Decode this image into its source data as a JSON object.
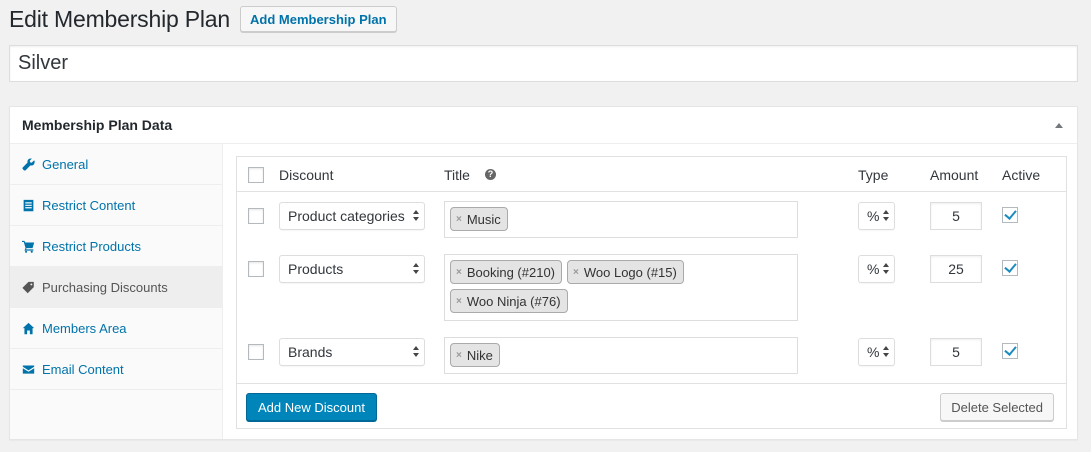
{
  "page": {
    "title": "Edit Membership Plan",
    "add_button": "Add Membership Plan",
    "plan_name": "Silver"
  },
  "postbox": {
    "title": "Membership Plan Data"
  },
  "sidebar": {
    "items": [
      {
        "label": "General",
        "icon": "wrench-icon",
        "active": false
      },
      {
        "label": "Restrict Content",
        "icon": "document-icon",
        "active": false
      },
      {
        "label": "Restrict Products",
        "icon": "cart-icon",
        "active": false
      },
      {
        "label": "Purchasing Discounts",
        "icon": "tag-icon",
        "active": true
      },
      {
        "label": "Members Area",
        "icon": "home-icon",
        "active": false
      },
      {
        "label": "Email Content",
        "icon": "email-icon",
        "active": false
      }
    ]
  },
  "table": {
    "columns": {
      "discount": "Discount",
      "title": "Title",
      "type": "Type",
      "amount": "Amount",
      "active": "Active"
    },
    "rows": [
      {
        "discount": "Product categories",
        "titles": [
          "Music"
        ],
        "type": "%",
        "amount": "5",
        "active": true
      },
      {
        "discount": "Products",
        "titles": [
          "Booking (#210)",
          "Woo Logo (#15)",
          "Woo Ninja (#76)"
        ],
        "type": "%",
        "amount": "25",
        "active": true
      },
      {
        "discount": "Brands",
        "titles": [
          "Nike"
        ],
        "type": "%",
        "amount": "5",
        "active": true
      }
    ]
  },
  "footer": {
    "add_label": "Add New Discount",
    "delete_label": "Delete Selected"
  },
  "colors": {
    "link": "#0073aa",
    "primary_button": "#0085ba",
    "checkmark": "#1e8cbe",
    "background": "#f1f1f1"
  }
}
